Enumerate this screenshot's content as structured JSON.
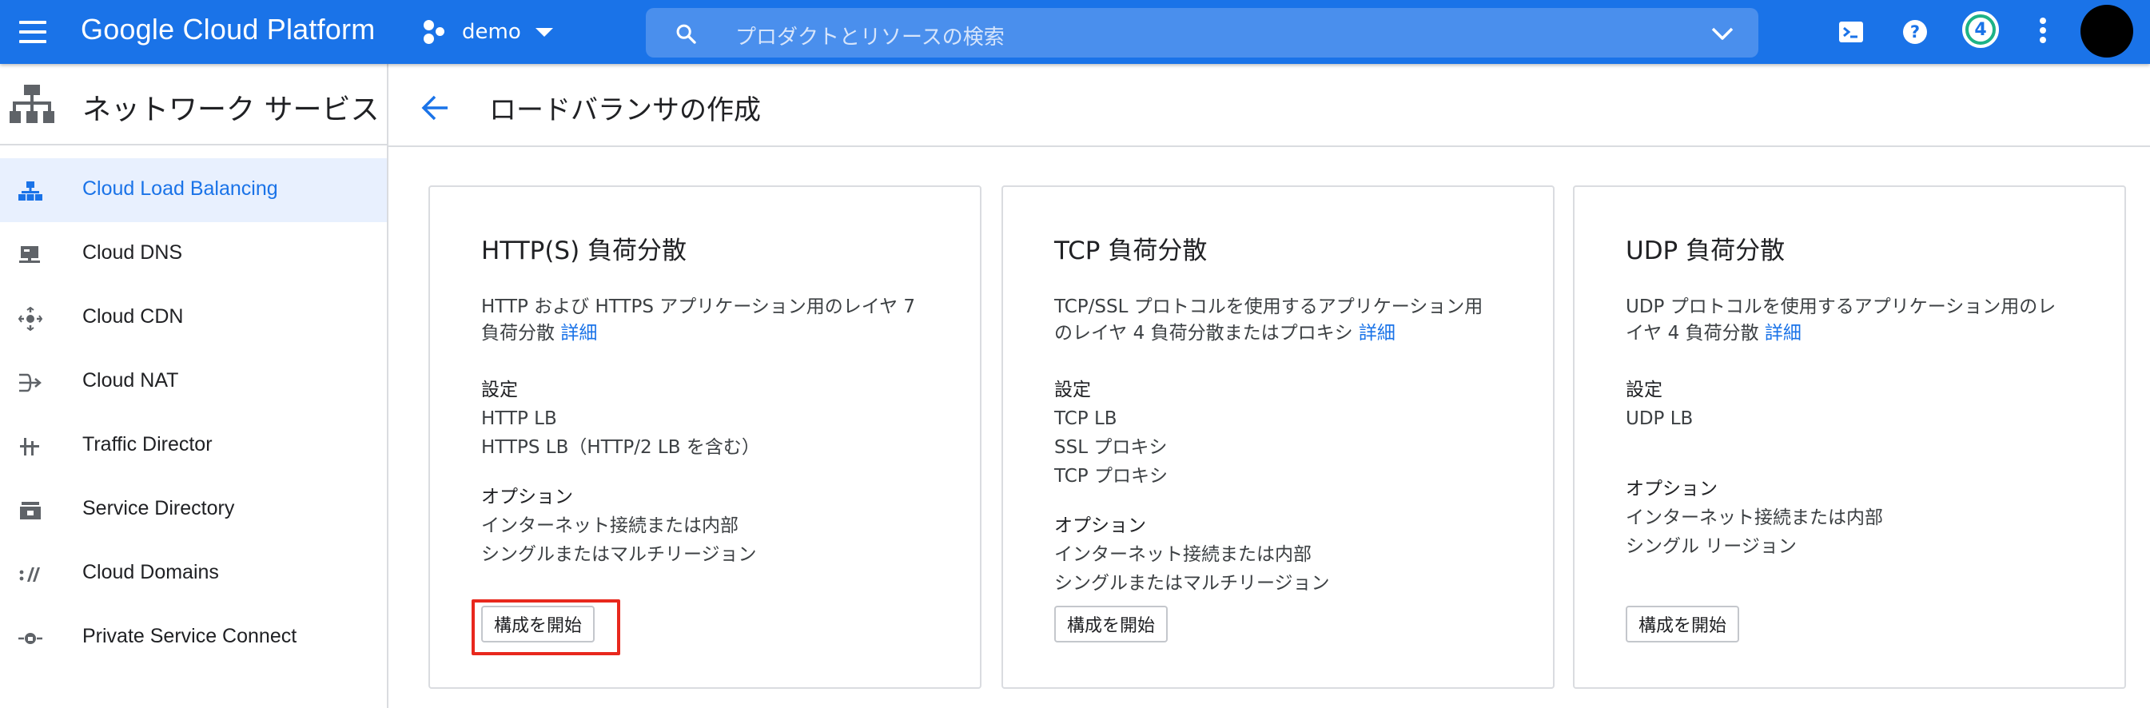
{
  "topbar": {
    "brand": "Google Cloud Platform",
    "project": "demo",
    "search_placeholder": "プロダクトとリソースの検索",
    "notification_count": "4",
    "colors": {
      "bar": "#1a73e8",
      "search": "#4a8fed",
      "badge_ring": "#1db387"
    },
    "icons": [
      "menu-icon",
      "project-dots-icon",
      "search-icon",
      "chevron-down-icon",
      "cloud-shell-icon",
      "help-icon",
      "more-vert-icon",
      "avatar"
    ]
  },
  "sidebar": {
    "title": "ネットワーク サービス",
    "items": [
      {
        "label": "Cloud Load Balancing",
        "icon": "load-balancing-icon",
        "active": true
      },
      {
        "label": "Cloud DNS",
        "icon": "dns-icon",
        "active": false
      },
      {
        "label": "Cloud CDN",
        "icon": "cdn-icon",
        "active": false
      },
      {
        "label": "Cloud NAT",
        "icon": "nat-icon",
        "active": false
      },
      {
        "label": "Traffic Director",
        "icon": "traffic-director-icon",
        "active": false
      },
      {
        "label": "Service Directory",
        "icon": "service-directory-icon",
        "active": false
      },
      {
        "label": "Cloud Domains",
        "icon": "domains-icon",
        "active": false
      },
      {
        "label": "Private Service Connect",
        "icon": "private-service-connect-icon",
        "active": false
      }
    ]
  },
  "main": {
    "title": "ロードバランサの作成",
    "cards": [
      {
        "title": "HTTP(S) 負荷分散",
        "desc_line1": "HTTP および HTTPS アプリケーション用のレイヤ 7",
        "desc_line2": "負荷分散",
        "link": "詳細",
        "settings_heading": "設定",
        "settings": [
          "HTTP LB",
          "HTTPS LB（HTTP/2 LB を含む）"
        ],
        "options_heading": "オプション",
        "options": [
          "インターネット接続または内部",
          "シングルまたはマルチリージョン"
        ],
        "button": "構成を開始"
      },
      {
        "title": "TCP 負荷分散",
        "desc_line1": "TCP/SSL プロトコルを使用するアプリケーション用",
        "desc_line2": "のレイヤ 4 負荷分散またはプロキシ",
        "link": "詳細",
        "settings_heading": "設定",
        "settings": [
          "TCP LB",
          "SSL プロキシ",
          "TCP プロキシ"
        ],
        "options_heading": "オプション",
        "options": [
          "インターネット接続または内部",
          "シングルまたはマルチリージョン"
        ],
        "button": "構成を開始"
      },
      {
        "title": "UDP 負荷分散",
        "desc_line1": "UDP プロトコルを使用するアプリケーション用のレ",
        "desc_line2": "イヤ 4 負荷分散",
        "link": "詳細",
        "settings_heading": "設定",
        "settings": [
          "UDP LB"
        ],
        "options_heading": "オプション",
        "options": [
          "インターネット接続または内部",
          "シングル リージョン"
        ],
        "button": "構成を開始"
      }
    ],
    "highlight_color": "#e8281d"
  }
}
